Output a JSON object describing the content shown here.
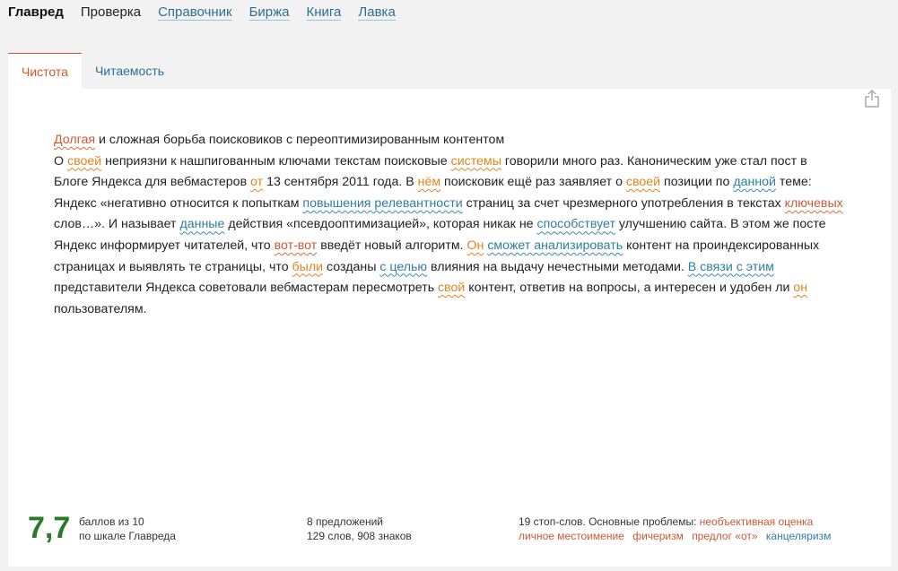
{
  "nav": {
    "brand": "Главред",
    "check": "Проверка",
    "links": [
      "Справочник",
      "Биржа",
      "Книга",
      "Лавка"
    ]
  },
  "tabs": [
    "Чистота",
    "Читаемость"
  ],
  "text": {
    "title": {
      "w1": "Долгая",
      "rest": " и сложная борьба поисковиков с переоптимизированным контентом"
    },
    "p": [
      "О ",
      "своей",
      " неприязни к нашпигованным ключами текстам поисковые ",
      "системы",
      " говорили много раз. Каноническим уже стал пост в Блоге Яндекса для вебмастеров ",
      "от",
      " 13 сентября 2011 года. В ",
      "нём",
      " поисковик ещё раз заявляет о ",
      "своей",
      " позиции по ",
      "данной",
      " теме: Яндекс «негативно относится к попыткам ",
      "повышения релевантности",
      " страниц за счет чрезмерного употребления в текстах ",
      "ключевых",
      " слов…». И называет ",
      "данные",
      " действия «псевдооптимизацией», которая никак не ",
      "способствует",
      " улучшению сайта. В этом же посте Яндекс информирует читателей, что ",
      "вот-вот",
      " введёт новый алгоритм. ",
      "Он",
      " ",
      "сможет анализировать",
      " контент на проиндексированных страницах и выявлять те страницы, что ",
      "были",
      " созданы ",
      "с целью",
      " влияния на выдачу нечестными методами. ",
      "В связи с этим",
      " представители Яндекса советовали вебмастерам пересмотреть ",
      "свой",
      " контент, ответив на вопросы, а интересен и удобен ли ",
      "он",
      " пользователям."
    ]
  },
  "footer": {
    "score": "7,7",
    "score_line1": "баллов из 10",
    "score_line2": "по шкале Главреда",
    "stats_line1": "8 предложений",
    "stats_line2": "129 слов, 908 знаков",
    "problems_prefix": "19 стоп-слов. Основные проблемы: ",
    "problems": [
      "необъективная оценка",
      "личное местоимение",
      "фичеризм",
      "предлог «от»",
      "канцеляризм"
    ]
  },
  "colors": {
    "accent": "#d0582b",
    "link": "#2d6e95",
    "score": "#2b7a2b"
  },
  "icons": {
    "share": "share-icon"
  }
}
